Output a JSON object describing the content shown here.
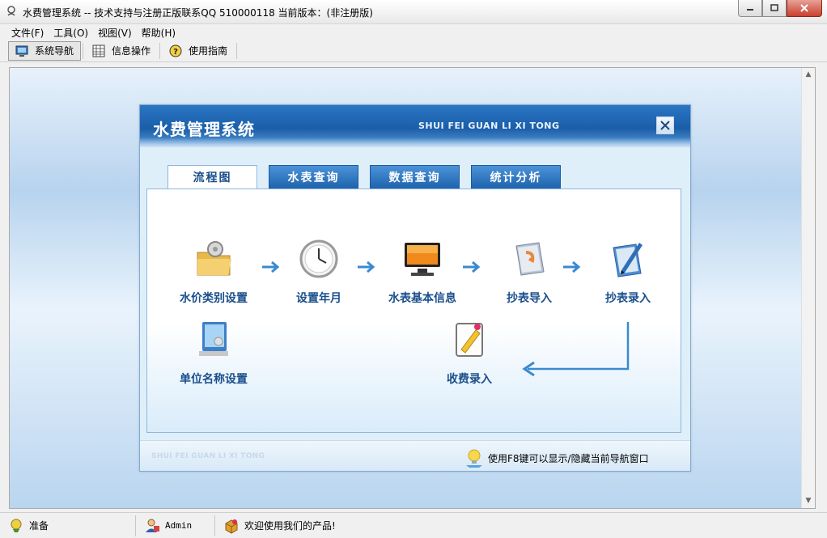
{
  "window": {
    "title": "水费管理系统 -- 技术支持与注册正版联系QQ 510000118    当前版本：(非注册版)",
    "controls": [
      "minimize-icon",
      "maximize-icon",
      "close-icon"
    ]
  },
  "menu": {
    "items": [
      "文件(F)",
      "工具(O)",
      "视图(V)",
      "帮助(H)"
    ]
  },
  "toolbar": {
    "items": [
      {
        "label": "系统导航",
        "icon": "monitor-icon",
        "active": true
      },
      {
        "label": "信息操作",
        "icon": "grid-icon",
        "active": false
      },
      {
        "label": "使用指南",
        "icon": "help-icon",
        "active": false
      }
    ]
  },
  "panel": {
    "title": "水费管理系统",
    "pinyin": "SHUI FEI GUAN LI XI TONG",
    "tabs": [
      {
        "label": "流程图",
        "active": true
      },
      {
        "label": "水表查询",
        "active": false
      },
      {
        "label": "数据查询",
        "active": false
      },
      {
        "label": "统计分析",
        "active": false
      }
    ],
    "flow": {
      "row1": [
        "水价类别设置",
        "设置年月",
        "水表基本信息",
        "抄表导入",
        "抄表录入"
      ],
      "row2": [
        "单位名称设置",
        "收费录入"
      ]
    },
    "footer_pinyin": "SHUI FEI GUAN LI XI TONG",
    "footer_tip": "使用F8键可以显示/隐藏当前导航窗口"
  },
  "statusbar": {
    "status": "准备",
    "user": "Admin",
    "message": "欢迎使用我们的产品!"
  },
  "colors": {
    "accent": "#1e63ad",
    "label_blue": "#1a4f8c",
    "arrow_blue": "#3a8ad0"
  }
}
